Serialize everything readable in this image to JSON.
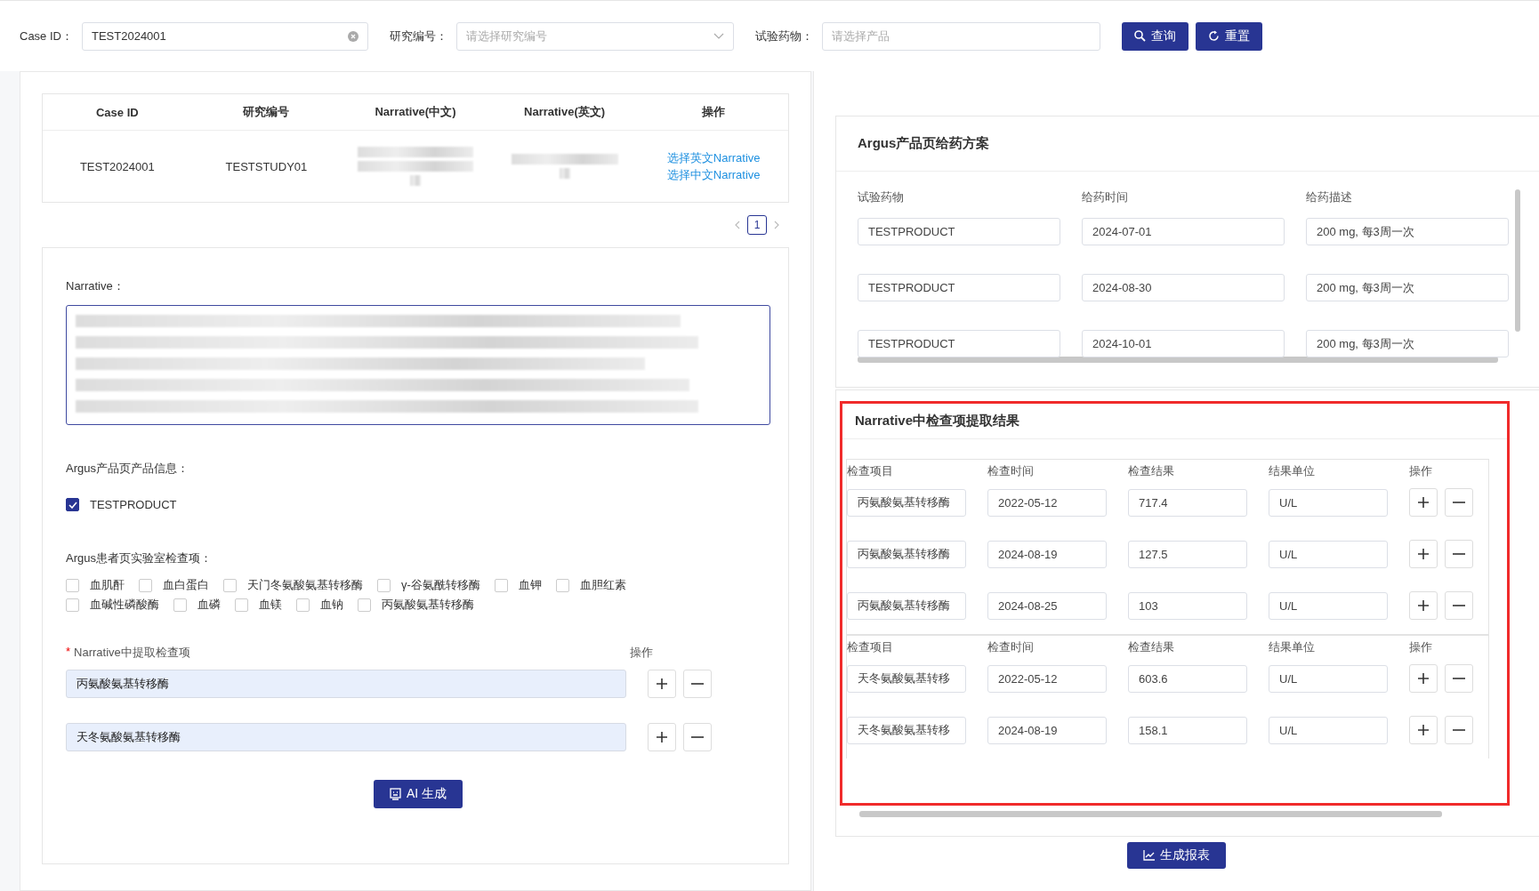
{
  "search": {
    "fields": [
      {
        "kind": "clearable",
        "label": "Case ID：",
        "value": "TEST2024001"
      },
      {
        "kind": "select",
        "label": "研究编号：",
        "placeholder": "请选择研究编号"
      },
      {
        "kind": "text",
        "label": "试验药物：",
        "placeholder": "请选择产品"
      }
    ],
    "buttons": [
      {
        "kind": "search",
        "label": "查询"
      },
      {
        "kind": "reset",
        "label": "重置"
      }
    ]
  },
  "case_table": {
    "columns": [
      "Case ID",
      "研究编号",
      "Narrative(中文)",
      "Narrative(英文)",
      "操作"
    ],
    "rows": [
      {
        "case_id": "TEST2024001",
        "study": "TESTSTUDY01",
        "actions": [
          "选择英文Narrative",
          "选择中文Narrative"
        ]
      }
    ]
  },
  "pagination": {
    "pages": [
      {
        "label": "1",
        "selected": true
      }
    ]
  },
  "narrative": {
    "label": "Narrative："
  },
  "product_info": {
    "label": "Argus产品页产品信息：",
    "items": [
      {
        "label": "TESTPRODUCT",
        "checked": true
      }
    ]
  },
  "lab_items": {
    "label": "Argus患者页实验室检查项：",
    "items": [
      {
        "label": "血肌酐",
        "checked": false
      },
      {
        "label": "血白蛋白",
        "checked": false
      },
      {
        "label": "天门冬氨酸氨基转移酶",
        "checked": false
      },
      {
        "label": "γ-谷氨酰转移酶",
        "checked": false
      },
      {
        "label": "血钾",
        "checked": false
      },
      {
        "label": "血胆红素",
        "checked": false
      },
      {
        "label": "血碱性磷酸酶",
        "checked": false
      },
      {
        "label": "血磷",
        "checked": false
      },
      {
        "label": "血镁",
        "checked": false
      },
      {
        "label": "血钠",
        "checked": false
      },
      {
        "label": "丙氨酸氨基转移酶",
        "checked": false
      }
    ]
  },
  "extracted": {
    "label": "Narrative中提取检查项",
    "required_mark": "*",
    "action_header": "操作",
    "items": [
      {
        "value": "丙氨酸氨基转移酶"
      },
      {
        "value": "天冬氨酸氨基转移酶"
      }
    ]
  },
  "ai_button": {
    "label": "AI 生成"
  },
  "dosing": {
    "title": "Argus产品页给药方案",
    "columns": [
      "试验药物",
      "给药时间",
      "给药描述"
    ],
    "rows": [
      [
        "TESTPRODUCT",
        "2024-07-01",
        "200 mg, 每3周一次"
      ],
      [
        "TESTPRODUCT",
        "2024-08-30",
        "200 mg, 每3周一次"
      ],
      [
        "TESTPRODUCT",
        "2024-10-01",
        "200 mg, 每3周一次"
      ]
    ]
  },
  "results": {
    "title": "Narrative中检查项提取结果",
    "highlighted": true,
    "groups": [
      {
        "columns": [
          "检查项目",
          "检查时间",
          "检查结果",
          "结果单位",
          "操作"
        ],
        "rows": [
          [
            "丙氨酸氨基转移酶",
            "2022-05-12",
            "717.4",
            "U/L"
          ],
          [
            "丙氨酸氨基转移酶",
            "2024-08-19",
            "127.5",
            "U/L"
          ],
          [
            "丙氨酸氨基转移酶",
            "2024-08-25",
            "103",
            "U/L"
          ]
        ]
      },
      {
        "columns": [
          "检查项目",
          "检查时间",
          "检查结果",
          "结果单位",
          "操作"
        ],
        "rows": [
          [
            "天冬氨酸氨基转移",
            "2022-05-12",
            "603.6",
            "U/L"
          ],
          [
            "天冬氨酸氨基转移",
            "2024-08-19",
            "158.1",
            "U/L"
          ]
        ]
      }
    ]
  },
  "report_button": {
    "label": "生成报表"
  }
}
